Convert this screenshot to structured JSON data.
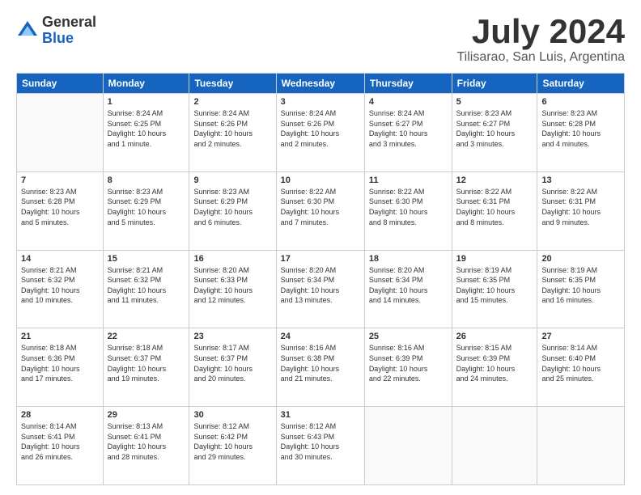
{
  "header": {
    "logo": {
      "general": "General",
      "blue": "Blue"
    },
    "title": "July 2024",
    "location": "Tilisarao, San Luis, Argentina"
  },
  "days_header": [
    "Sunday",
    "Monday",
    "Tuesday",
    "Wednesday",
    "Thursday",
    "Friday",
    "Saturday"
  ],
  "weeks": [
    [
      {
        "num": "",
        "info": ""
      },
      {
        "num": "1",
        "info": "Sunrise: 8:24 AM\nSunset: 6:25 PM\nDaylight: 10 hours\nand 1 minute."
      },
      {
        "num": "2",
        "info": "Sunrise: 8:24 AM\nSunset: 6:26 PM\nDaylight: 10 hours\nand 2 minutes."
      },
      {
        "num": "3",
        "info": "Sunrise: 8:24 AM\nSunset: 6:26 PM\nDaylight: 10 hours\nand 2 minutes."
      },
      {
        "num": "4",
        "info": "Sunrise: 8:24 AM\nSunset: 6:27 PM\nDaylight: 10 hours\nand 3 minutes."
      },
      {
        "num": "5",
        "info": "Sunrise: 8:23 AM\nSunset: 6:27 PM\nDaylight: 10 hours\nand 3 minutes."
      },
      {
        "num": "6",
        "info": "Sunrise: 8:23 AM\nSunset: 6:28 PM\nDaylight: 10 hours\nand 4 minutes."
      }
    ],
    [
      {
        "num": "7",
        "info": "Sunrise: 8:23 AM\nSunset: 6:28 PM\nDaylight: 10 hours\nand 5 minutes."
      },
      {
        "num": "8",
        "info": "Sunrise: 8:23 AM\nSunset: 6:29 PM\nDaylight: 10 hours\nand 5 minutes."
      },
      {
        "num": "9",
        "info": "Sunrise: 8:23 AM\nSunset: 6:29 PM\nDaylight: 10 hours\nand 6 minutes."
      },
      {
        "num": "10",
        "info": "Sunrise: 8:22 AM\nSunset: 6:30 PM\nDaylight: 10 hours\nand 7 minutes."
      },
      {
        "num": "11",
        "info": "Sunrise: 8:22 AM\nSunset: 6:30 PM\nDaylight: 10 hours\nand 8 minutes."
      },
      {
        "num": "12",
        "info": "Sunrise: 8:22 AM\nSunset: 6:31 PM\nDaylight: 10 hours\nand 8 minutes."
      },
      {
        "num": "13",
        "info": "Sunrise: 8:22 AM\nSunset: 6:31 PM\nDaylight: 10 hours\nand 9 minutes."
      }
    ],
    [
      {
        "num": "14",
        "info": "Sunrise: 8:21 AM\nSunset: 6:32 PM\nDaylight: 10 hours\nand 10 minutes."
      },
      {
        "num": "15",
        "info": "Sunrise: 8:21 AM\nSunset: 6:32 PM\nDaylight: 10 hours\nand 11 minutes."
      },
      {
        "num": "16",
        "info": "Sunrise: 8:20 AM\nSunset: 6:33 PM\nDaylight: 10 hours\nand 12 minutes."
      },
      {
        "num": "17",
        "info": "Sunrise: 8:20 AM\nSunset: 6:34 PM\nDaylight: 10 hours\nand 13 minutes."
      },
      {
        "num": "18",
        "info": "Sunrise: 8:20 AM\nSunset: 6:34 PM\nDaylight: 10 hours\nand 14 minutes."
      },
      {
        "num": "19",
        "info": "Sunrise: 8:19 AM\nSunset: 6:35 PM\nDaylight: 10 hours\nand 15 minutes."
      },
      {
        "num": "20",
        "info": "Sunrise: 8:19 AM\nSunset: 6:35 PM\nDaylight: 10 hours\nand 16 minutes."
      }
    ],
    [
      {
        "num": "21",
        "info": "Sunrise: 8:18 AM\nSunset: 6:36 PM\nDaylight: 10 hours\nand 17 minutes."
      },
      {
        "num": "22",
        "info": "Sunrise: 8:18 AM\nSunset: 6:37 PM\nDaylight: 10 hours\nand 19 minutes."
      },
      {
        "num": "23",
        "info": "Sunrise: 8:17 AM\nSunset: 6:37 PM\nDaylight: 10 hours\nand 20 minutes."
      },
      {
        "num": "24",
        "info": "Sunrise: 8:16 AM\nSunset: 6:38 PM\nDaylight: 10 hours\nand 21 minutes."
      },
      {
        "num": "25",
        "info": "Sunrise: 8:16 AM\nSunset: 6:39 PM\nDaylight: 10 hours\nand 22 minutes."
      },
      {
        "num": "26",
        "info": "Sunrise: 8:15 AM\nSunset: 6:39 PM\nDaylight: 10 hours\nand 24 minutes."
      },
      {
        "num": "27",
        "info": "Sunrise: 8:14 AM\nSunset: 6:40 PM\nDaylight: 10 hours\nand 25 minutes."
      }
    ],
    [
      {
        "num": "28",
        "info": "Sunrise: 8:14 AM\nSunset: 6:41 PM\nDaylight: 10 hours\nand 26 minutes."
      },
      {
        "num": "29",
        "info": "Sunrise: 8:13 AM\nSunset: 6:41 PM\nDaylight: 10 hours\nand 28 minutes."
      },
      {
        "num": "30",
        "info": "Sunrise: 8:12 AM\nSunset: 6:42 PM\nDaylight: 10 hours\nand 29 minutes."
      },
      {
        "num": "31",
        "info": "Sunrise: 8:12 AM\nSunset: 6:43 PM\nDaylight: 10 hours\nand 30 minutes."
      },
      {
        "num": "",
        "info": ""
      },
      {
        "num": "",
        "info": ""
      },
      {
        "num": "",
        "info": ""
      }
    ]
  ]
}
